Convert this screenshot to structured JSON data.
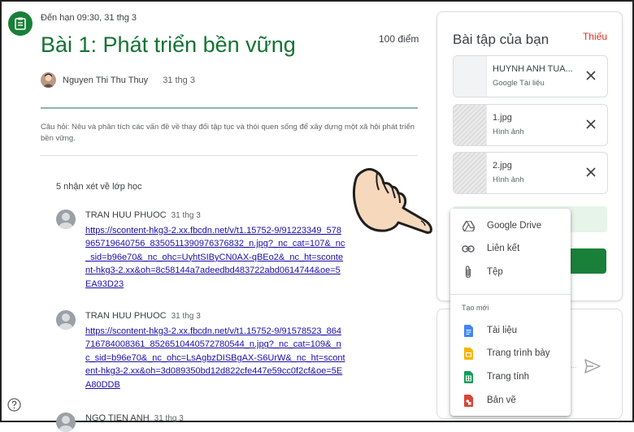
{
  "assignment": {
    "due": "Đến hạn 09:30, 31 thg 3",
    "title": "Bài 1: Phát triển bền vững",
    "points": "100 điểm",
    "author": {
      "name": "Nguyen Thi Thu Thuy",
      "date": "31 thg 3"
    },
    "question": "Câu hỏi: Nêu và phân tích các vấn đề về thay đổi tập tục và thói quen sống để xây dựng một xã hội phát triển bền vững."
  },
  "comments": {
    "title": "5 nhận xét về lớp học",
    "items": [
      {
        "author": "TRAN HUU PHUOC",
        "date": "31 thg 3",
        "link": "https://scontent-hkg3-2.xx.fbcdn.net/v/t1.15752-9/91223349_578965719640756_8350511390976376832_n.jpg?_nc_cat=107&_nc_sid=b96e70&_nc_ohc=UyhtSIByCN0AX-qBEo2&_nc_ht=scontent-hkg3-2.xx&oh=8c58144a7adeedbd483722abd0614744&oe=5EA93D23"
      },
      {
        "author": "TRAN HUU PHUOC",
        "date": "31 thg 3",
        "link": "https://scontent-hkg3-2.xx.fbcdn.net/v/t1.15752-9/91578523_864716784008361_8526510440572780544_n.jpg?_nc_cat=109&_nc_sid=b96e70&_nc_ohc=LsAgbzDISBgAX-S6UrW&_nc_ht=scontent-hkg3-2.xx&oh=3d089350bd12d822cfe447e59cc0f2cf&oe=5EA80DDB"
      },
      {
        "author": "NGO TIEN ANH",
        "date": "31 thg 3",
        "link": ""
      }
    ]
  },
  "work_panel": {
    "title": "Bài tập của bạn",
    "status": "Thiếu",
    "files": [
      {
        "name": "HUYNH ANH TUA...",
        "type": "Google Tài liệu",
        "thumb": "doc"
      },
      {
        "name": "1.jpg",
        "type": "Hình ảnh",
        "thumb": "image"
      },
      {
        "name": "2.jpg",
        "type": "Hình ảnh",
        "thumb": "image"
      }
    ]
  },
  "add_menu": {
    "items": [
      {
        "label": "Google Drive",
        "icon": "google-drive-icon"
      },
      {
        "label": "Liên kết",
        "icon": "link-icon"
      },
      {
        "label": "Tệp",
        "icon": "paperclip-icon"
      }
    ],
    "create_section": "Tạo mới",
    "create_items": [
      {
        "label": "Tài liệu",
        "icon": "docs-icon",
        "color": "#4285f4"
      },
      {
        "label": "Trang trình bày",
        "icon": "slides-icon",
        "color": "#f4b400"
      },
      {
        "label": "Trang tính",
        "icon": "sheets-icon",
        "color": "#0f9d58"
      },
      {
        "label": "Bản vẽ",
        "icon": "drawings-icon",
        "color": "#db4437"
      }
    ]
  },
  "colors": {
    "title_green": "#137333",
    "accent_green": "#188038",
    "missing_red": "#d93025",
    "link_blue": "#1a0dab"
  }
}
